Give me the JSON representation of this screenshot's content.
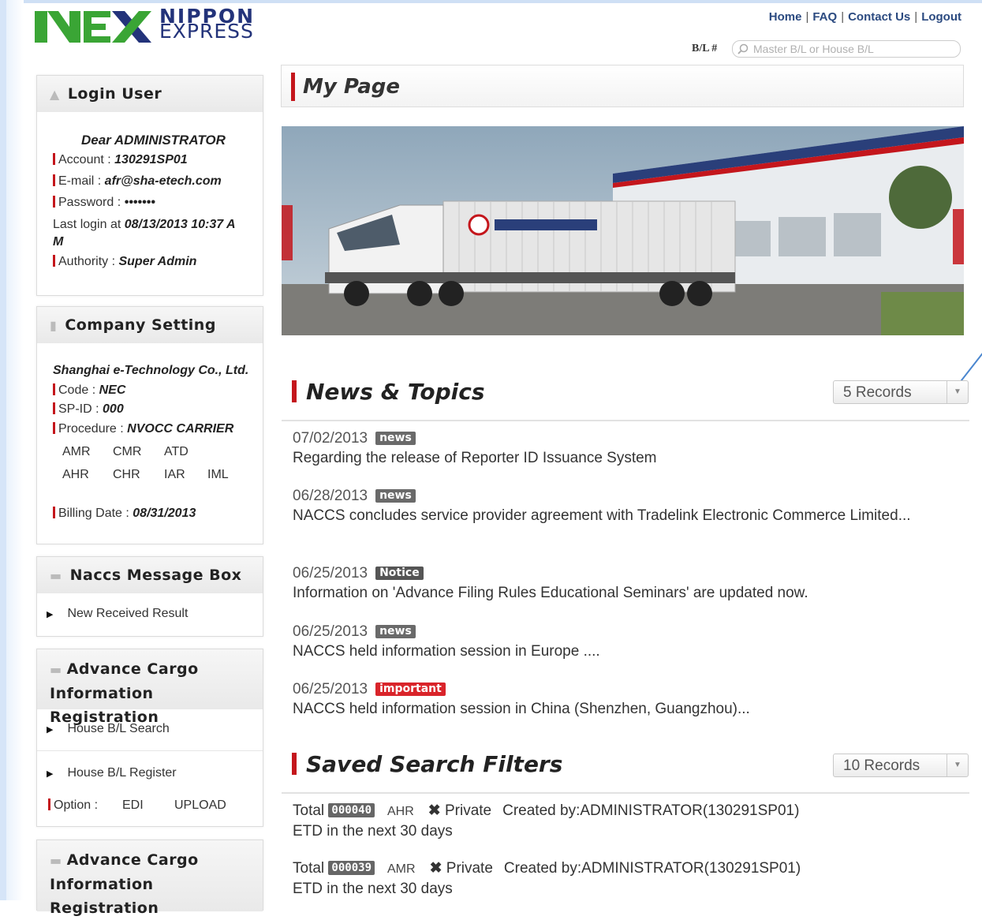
{
  "header": {
    "logo_line1": "NIPPON",
    "logo_line2": "EXPRESS",
    "links": [
      "Home",
      "FAQ",
      "Contact Us",
      "Logout"
    ],
    "bl_label": "B/L #",
    "bl_placeholder": "Master B/L or House B/L"
  },
  "login_user": {
    "title": "Login User",
    "greeting": "Dear ADMINISTRATOR",
    "account_label": "Account : ",
    "account": "130291SP01",
    "email_label": "E-mail : ",
    "email": "afr@sha-etech.com",
    "password_label": "Password : ",
    "password": "•••••••",
    "last_login_label": "Last login at ",
    "last_login": "08/13/2013 10:37 A",
    "last_login_cont": "M",
    "authority_label": "Authority : ",
    "authority": "Super Admin"
  },
  "company": {
    "title": "Company Setting",
    "name": "Shanghai e-Technology Co., Ltd.",
    "code_label": "Code : ",
    "code": "NEC",
    "spid_label": "SP-ID : ",
    "spid": "000",
    "procedure_label": "Procedure : ",
    "procedure": "NVOCC  CARRIER",
    "codes_row1": [
      "AMR",
      "CMR",
      "ATD"
    ],
    "codes_row2": [
      "AHR",
      "CHR",
      "IAR",
      "IML"
    ],
    "billing_label": "Billing Date : ",
    "billing": "08/31/2013"
  },
  "naccs": {
    "title": "Naccs Message Box",
    "item": "New Received Result"
  },
  "acir1": {
    "title_line1": "Advance Cargo",
    "title_line2": "Information Registration",
    "items": [
      "House B/L Search",
      "House B/L Register"
    ],
    "option_label": "Option : ",
    "options": [
      "EDI",
      "UPLOAD"
    ]
  },
  "acir2": {
    "title_line1": "Advance Cargo",
    "title_line2": "Information Registration"
  },
  "main": {
    "page_title": "My Page",
    "news_title": "News & Topics",
    "news_records": "5 Records",
    "news": [
      {
        "date": "07/02/2013",
        "badge": "news",
        "text": "Regarding the release of Reporter ID Issuance System"
      },
      {
        "date": "06/28/2013",
        "badge": "news",
        "text": "NACCS concludes service provider agreement with Tradelink Electronic Commerce Limited..."
      },
      {
        "date": "06/25/2013",
        "badge": "Notice",
        "text": "Information on 'Advance Filing Rules Educational Seminars' are updated now."
      },
      {
        "date": "06/25/2013",
        "badge": "news",
        "text": "NACCS held information session in Europe ...."
      },
      {
        "date": "06/25/2013",
        "badge": "important",
        "text": "NACCS held information session in China (Shenzhen, Guangzhou)..."
      }
    ],
    "filters_title": "Saved Search Filters",
    "filters_records": "10 Records",
    "filters": [
      {
        "total_label": "Total",
        "count": "000040",
        "tag": "AHR",
        "visibility": "Private",
        "created": "Created by:ADMINISTRATOR(130291SP01)",
        "desc": "ETD in the next 30 days"
      },
      {
        "total_label": "Total",
        "count": "000039",
        "tag": "AMR",
        "visibility": "Private",
        "created": "Created by:ADMINISTRATOR(130291SP01)",
        "desc": "ETD in the next 30 days"
      }
    ]
  },
  "colors": {
    "accent_red": "#c4161c",
    "logo_green": "#3aa535",
    "logo_navy": "#23337a",
    "badge_news": "#6a6a6a",
    "badge_notice": "#555555",
    "badge_important": "#d9242a"
  }
}
